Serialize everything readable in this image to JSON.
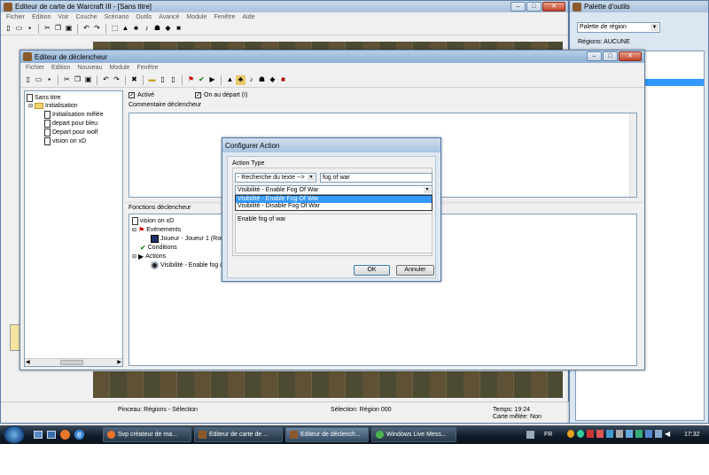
{
  "main_window": {
    "title": "Editeur de carte de Warcraft III - [Sans titre]",
    "menu": [
      "Fichier",
      "Edition",
      "Voir",
      "Couche",
      "Scénario",
      "Outils",
      "Avancé",
      "Module",
      "Fenêtre",
      "Aide"
    ],
    "status": {
      "brush": "Pinceau: Régions - Sélection",
      "selection": "Sélection: Région 000",
      "time": "Temps: 19:24",
      "melee": "Carte mêlée: Non"
    }
  },
  "palette_window": {
    "title": "Palette d'outils",
    "dropdown_value": "Palette de région",
    "regions_label": "Régions: AUCUNE"
  },
  "trigger_window": {
    "title": "Editeur de déclencheur",
    "menu": [
      "Fichier",
      "Edition",
      "Nouveau",
      "Module",
      "Fenêtre"
    ],
    "tree": {
      "root": "Sans titre",
      "folder": "Initialisation",
      "items": [
        "Initialisation mêlée",
        "depart pour bleu",
        "Depart pour wolf",
        "vision on xD"
      ]
    },
    "enabled_label": "Activé",
    "initially_on_label": "On au départ (I)",
    "comment_label": "Commentaire déclencheur",
    "functions_label": "Fonctions déclencheur",
    "functions": {
      "name": "vision on xD",
      "events": "Evénements",
      "event_item": "Joueur - Joueur 1 (Rouge)",
      "conditions": "Conditions",
      "actions": "Actions",
      "action_item": "Visibilité - Enable fog of"
    }
  },
  "dialog": {
    "title": "Configurer Action",
    "action_type_label": "Action Type",
    "search_mode": "- Recherche du texte -->",
    "search_text": "fog of war",
    "selected_action": "Visibilité - Enable Fog Of War",
    "options": [
      "Visibilité - Enable Fog Of War",
      "Visibilité - Disable Fog Of War"
    ],
    "description": "Enable fog of war",
    "ok_label": "OK",
    "cancel_label": "Annuler"
  },
  "taskbar": {
    "tasks": [
      "Svp créateur de ma...",
      "Editeur de carte de ...",
      "Editeur de déclench...",
      "Windows Live Mess..."
    ],
    "lang": "FR",
    "clock": "17:32"
  },
  "colors": {
    "selection_blue": "#3399ff",
    "title_blue": "#8fb0d6",
    "taskbar_dark": "#0f1a26"
  }
}
